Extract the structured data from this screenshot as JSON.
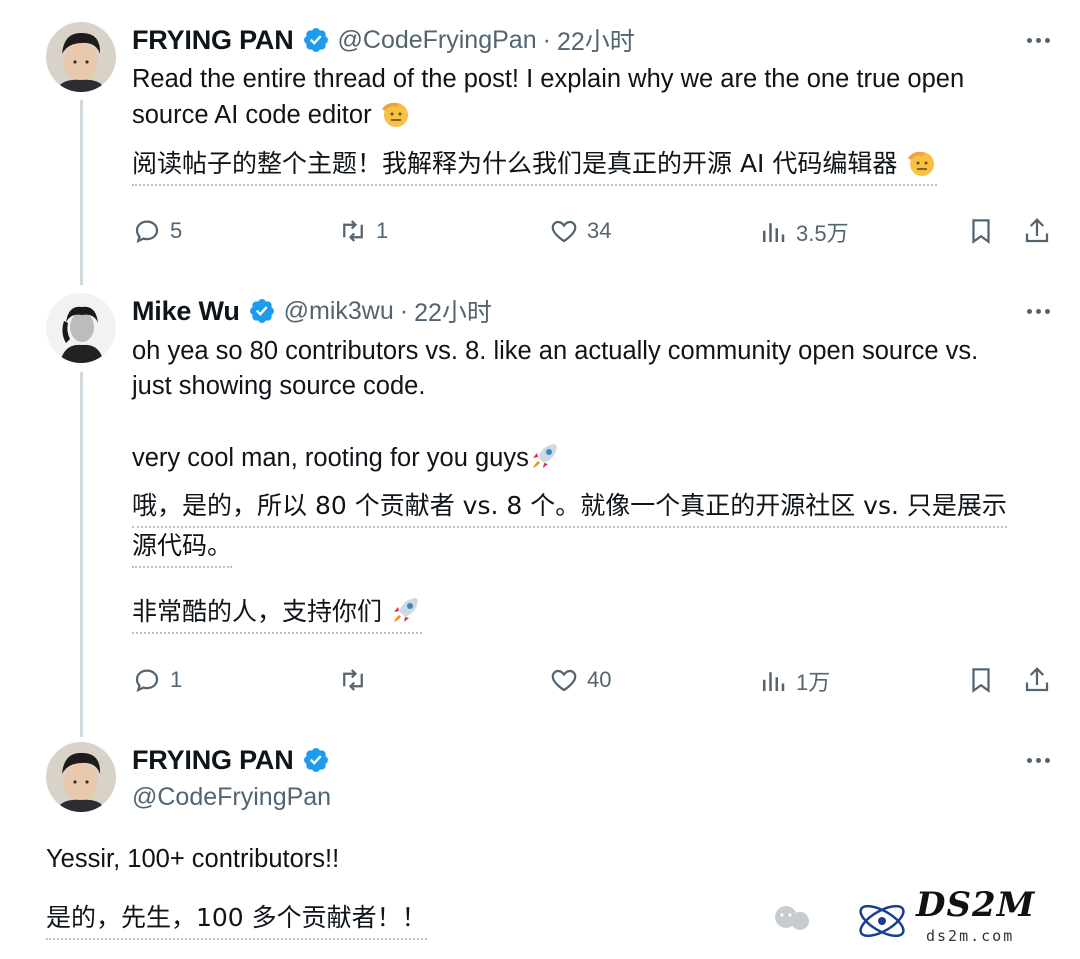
{
  "tweets": [
    {
      "name": "FRYING PAN",
      "handle": "@CodeFryingPan",
      "time": "22小时",
      "text_line1": "Read the entire thread of the post! I explain why we are the one true open",
      "text_line2": "source AI code editor",
      "translation": "阅读帖子的整个主题！我解释为什么我们是真正的开源 AI 代码编辑器",
      "replies": "5",
      "retweets": "1",
      "likes": "34",
      "views": "3.5万"
    },
    {
      "name": "Mike Wu",
      "handle": "@mik3wu",
      "time": "22小时",
      "text_line1": "oh yea so 80 contributors vs. 8. like an actually community open source vs.",
      "text_line2": "just showing source code.",
      "text_line3": "very cool man, rooting for you guys",
      "translation_line1": "哦，是的，所以 80 个贡献者 vs. 8 个。就像一个真正的开源社区 vs. 只是展示",
      "translation_line2": "源代码。",
      "translation_line3": "非常酷的人，支持你们",
      "replies": "1",
      "retweets": "",
      "likes": "40",
      "views": "1万"
    },
    {
      "name": "FRYING PAN",
      "handle": "@CodeFryingPan",
      "text": "Yessir, 100+ contributors!!",
      "translation": "是的，先生，100 多个贡献者！！"
    }
  ],
  "watermark": {
    "brand": "DS2M",
    "site": "ds2m.com"
  },
  "colors": {
    "verified": "#1d9bf0",
    "muted": "#536471",
    "thread_line": "#cfd9de"
  }
}
